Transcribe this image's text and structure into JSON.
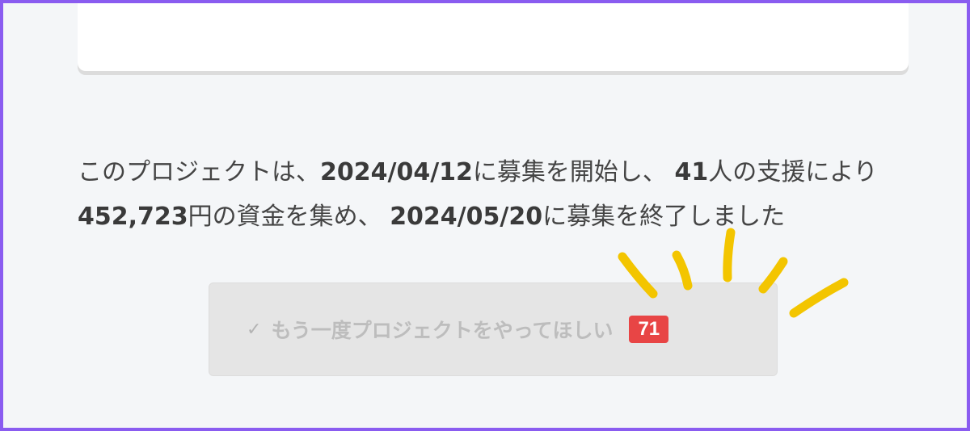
{
  "summary": {
    "t1": "このプロジェクトは、",
    "start_date": "2024/04/12",
    "t2": "に募集を開始し、 ",
    "supporters": "41",
    "t3": "人の支援により ",
    "amount": "452,723",
    "t4": "円の資金を集め、 ",
    "end_date": "2024/05/20",
    "t5": "に募集を終了しました"
  },
  "request_again": {
    "check_glyph": "✓",
    "label": "もう一度プロジェクトをやってほしい",
    "count": "71"
  },
  "icons": {
    "check": "check-icon",
    "highlight": "highlight-burst-icon"
  },
  "colors": {
    "frame_border": "#8a5cf0",
    "badge": "#e84545",
    "highlight": "#f3c500"
  }
}
